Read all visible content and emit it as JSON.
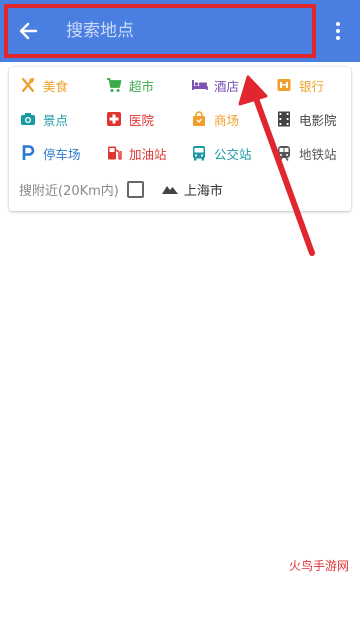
{
  "header": {
    "search_placeholder": "搜索地点",
    "back_icon": "arrow-left-icon",
    "menu_icon": "more-vert-icon",
    "bar_color": "#4a7ee0",
    "highlight_color": "#e0262f"
  },
  "categories": [
    {
      "label": "美食",
      "icon": "fork-knife-icon",
      "color": "#f0a02a"
    },
    {
      "label": "超市",
      "icon": "shopping-cart-icon",
      "color": "#3aab4a"
    },
    {
      "label": "酒店",
      "icon": "bed-icon",
      "color": "#7b53b4"
    },
    {
      "label": "银行",
      "icon": "bank-icon",
      "color": "#f0a02a"
    },
    {
      "label": "景点",
      "icon": "camera-icon",
      "color": "#199aa0"
    },
    {
      "label": "医院",
      "icon": "hospital-cross-icon",
      "color": "#e0352f"
    },
    {
      "label": "商场",
      "icon": "shopping-bag-icon",
      "color": "#f0a02a"
    },
    {
      "label": "电影院",
      "icon": "film-icon",
      "color": "#444444"
    },
    {
      "label": "停车场",
      "icon": "parking-icon",
      "color": "#2a78d0"
    },
    {
      "label": "加油站",
      "icon": "gas-station-icon",
      "color": "#e0352f"
    },
    {
      "label": "公交站",
      "icon": "bus-icon",
      "color": "#199aa0"
    },
    {
      "label": "地铁站",
      "icon": "subway-icon",
      "color": "#555555"
    }
  ],
  "nearby": {
    "label": "搜附近(20Km内)",
    "checked": false
  },
  "city": {
    "label": "上海市",
    "icon": "mountain-icon"
  },
  "watermark": "火鸟手游网"
}
